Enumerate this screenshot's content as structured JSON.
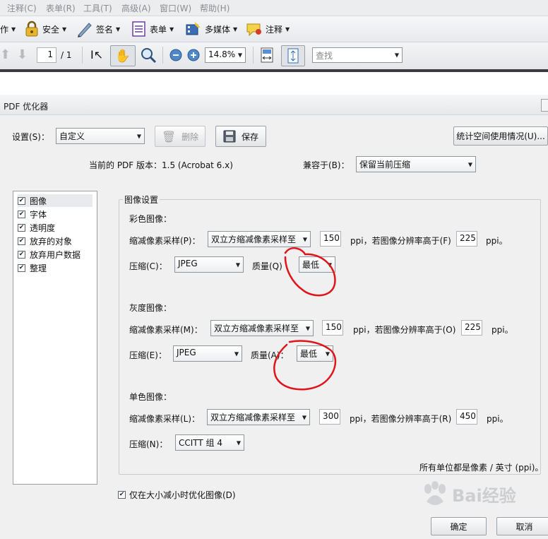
{
  "menu": [
    "注释(C)",
    "表单(R)",
    "工具(T)",
    "高级(A)",
    "窗口(W)",
    "帮助(H)"
  ],
  "toolbar": {
    "partial_label": "作",
    "security": "安全",
    "sign": "签名",
    "forms": "表单",
    "multimedia": "多媒体",
    "comment": "注释"
  },
  "nav": {
    "page_value": "1",
    "page_total": "/ 1",
    "zoom": "14.8%",
    "search_placeholder": "查找"
  },
  "dialog": {
    "title": "PDF 优化器",
    "settings_label": "设置(S)：",
    "settings_value": "自定义",
    "delete_label": "删除",
    "save_label": "保存",
    "stats_button": "统计空间使用情况(U)...",
    "version_text": "当前的 PDF 版本：1.5 (Acrobat 6.x)",
    "compat_label": "兼容于(B)：",
    "compat_value": "保留当前压缩",
    "categories": [
      "图像",
      "字体",
      "透明度",
      "放弃的对象",
      "放弃用户数据",
      "整理"
    ],
    "group_title": "图像设置",
    "color": {
      "heading": "彩色图像：",
      "downsample_label": "缩减像素采样(P)：",
      "downsample_value": "双立方缩减像素采样至",
      "ppi_value": "150",
      "above_label": "ppi，若图像分辨率高于(F)",
      "above_value": "225",
      "ppi_suffix": "ppi。",
      "compression_label": "压缩(C)：",
      "compression_value": "JPEG",
      "quality_label": "质量(Q)",
      "quality_value": "最低"
    },
    "gray": {
      "heading": "灰度图像：",
      "downsample_label": "缩减像素采样(M)：",
      "downsample_value": "双立方缩减像素采样至",
      "ppi_value": "150",
      "above_label": "ppi，若图像分辨率高于(O)",
      "above_value": "225",
      "ppi_suffix": "ppi。",
      "compression_label": "压缩(E)：",
      "compression_value": "JPEG",
      "quality_label": "质量(A)：",
      "quality_value": "最低"
    },
    "mono": {
      "heading": "单色图像：",
      "downsample_label": "缩减像素采样(L)：",
      "downsample_value": "双立方缩减像素采样至",
      "ppi_value": "300",
      "above_label": "ppi，若图像分辨率高于(R)",
      "above_value": "450",
      "ppi_suffix": "ppi。",
      "compression_label": "压缩(N)：",
      "compression_value": "CCITT 组 4"
    },
    "units_note": "所有单位都是像素 / 英寸 (ppi)。",
    "optimize_check_label": "仅在大小减小时优化图像(D)",
    "ok": "确定",
    "cancel": "取消"
  },
  "watermark": "Bai经验",
  "colors": {
    "annotation_red": "#e0141a",
    "accent": "#2d6db5"
  }
}
